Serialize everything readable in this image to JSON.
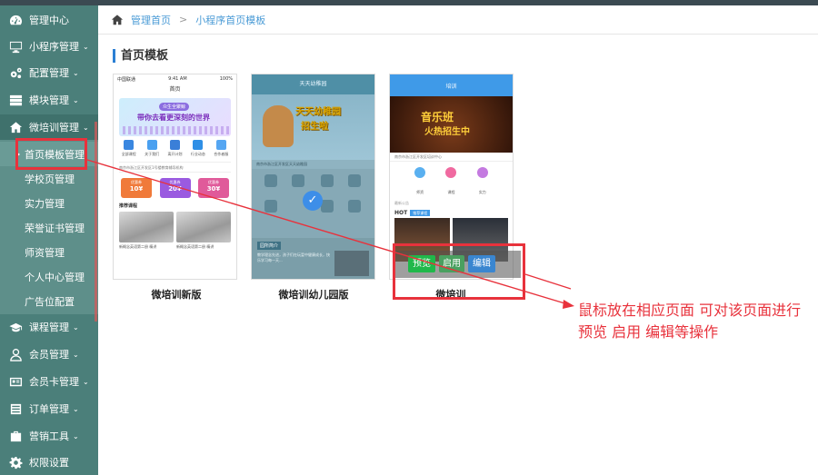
{
  "sidebar": {
    "items": [
      {
        "label": "管理中心",
        "icon": "dashboard-icon",
        "chevron": ""
      },
      {
        "label": "小程序管理",
        "icon": "monitor-icon",
        "chevron": "⌄"
      },
      {
        "label": "配置管理",
        "icon": "cogs-icon",
        "chevron": "⌄"
      },
      {
        "label": "模块管理",
        "icon": "server-icon",
        "chevron": "⌄"
      },
      {
        "label": "微培训管理",
        "icon": "home-icon",
        "chevron": "⌄"
      },
      {
        "label": "课程管理",
        "icon": "graduation-cap-icon",
        "chevron": "⌄"
      },
      {
        "label": "会员管理",
        "icon": "user-icon",
        "chevron": "⌄"
      },
      {
        "label": "会员卡管理",
        "icon": "id-card-icon",
        "chevron": "⌄"
      },
      {
        "label": "订单管理",
        "icon": "list-icon",
        "chevron": "⌄"
      },
      {
        "label": "营销工具",
        "icon": "briefcase-icon",
        "chevron": "⌄"
      },
      {
        "label": "权限设置",
        "icon": "gear-icon",
        "chevron": ""
      }
    ],
    "subitems": [
      {
        "label": "首页模板管理"
      },
      {
        "label": "学校页管理"
      },
      {
        "label": "实力管理"
      },
      {
        "label": "荣誉证书管理"
      },
      {
        "label": "师资管理"
      },
      {
        "label": "个人中心管理"
      },
      {
        "label": "广告位配置"
      }
    ]
  },
  "breadcrumb": {
    "home": "管理首页",
    "sep": ">",
    "current": "小程序首页模板"
  },
  "section_title": "首页模板",
  "templates": [
    {
      "name": "微培训新版",
      "status_left": "中国联通",
      "status_mid": "9:41 AM",
      "status_right": "100%",
      "header": "首页",
      "banner_tag": "众生全聚鲸",
      "banner_text": "带你去看更深刻的世界",
      "icons": [
        "全部课程",
        "关于我们",
        "离开计划",
        "行业动态",
        "合作者服"
      ],
      "address": "南京市浙江区开发区1号楼教育辅导机构",
      "stats": [
        {
          "title": "优惠券",
          "value": "10¥"
        },
        {
          "title": "优惠券",
          "value": "20¥"
        },
        {
          "title": "优惠券",
          "value": "30¥"
        }
      ],
      "rec_title": "推荐课程",
      "courses": [
        "新概念英语第二册 精讲",
        "新概念英语第二册 精讲"
      ]
    },
    {
      "name": "微培训幼儿园版",
      "bar_title": "天天幼稚园",
      "hero_line1": "天天幼稚园",
      "hero_line2": "招生啦",
      "address": "南京市浙江区开发区天天幼稚园",
      "tag": "园所简介",
      "text": "教学理念先进，孩子们在玩耍中健康成长，快乐学习每一天..."
    },
    {
      "name": "微培训",
      "bar_title": "培训",
      "hero_line1": "音乐班",
      "hero_line2": "火热招生中",
      "address": "南京市浙江区开发区培训中心",
      "circles": [
        {
          "label": "师资",
          "color": "#5ab0f0"
        },
        {
          "label": "课程",
          "color": "#f06aa0"
        },
        {
          "label": "实力",
          "color": "#c47ae0"
        }
      ],
      "news": "最新公告",
      "hot": "HOT",
      "hot_tag": "推荐课程"
    }
  ],
  "hover_actions": {
    "preview": "预览",
    "enable": "启用",
    "edit": "编辑"
  },
  "annotation": "鼠标放在相应页面 可对该页面进行预览 启用 编辑等操作"
}
